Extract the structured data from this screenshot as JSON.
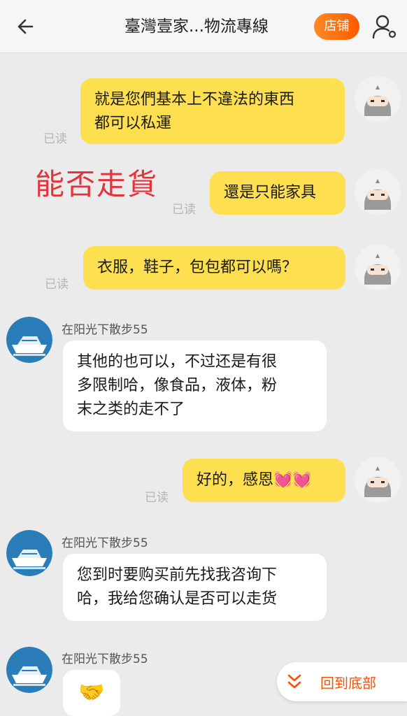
{
  "header": {
    "title": "臺灣壹家...物流專線",
    "shop_label": "店铺"
  },
  "watermark": "能否走貨",
  "messages": [
    {
      "text_lines": [
        "就是您們基本上不違法的東西",
        "都可以私運"
      ],
      "read": "已读"
    },
    {
      "text": "還是只能家具",
      "read": "已读"
    },
    {
      "text": "衣服，鞋子，包包都可以嗎？",
      "read": "已读"
    },
    {
      "sender": "在阳光下散步55",
      "text_lines": [
        "其他的也可以，不过还是有很",
        "多限制哈，像食品，液体，粉",
        "末之类的走不了"
      ]
    },
    {
      "text": "好的，感恩💓💓",
      "read": "已读"
    },
    {
      "sender": "在阳光下散步55",
      "text_lines": [
        "您到时要购买前先找我咨询下",
        "哈，我给您确认是否可以走货"
      ]
    },
    {
      "sender": "在阳光下散步55",
      "text": "🤝"
    }
  ],
  "floating": {
    "label": "回到底部"
  },
  "colors": {
    "me_bubble": "#fddf4f",
    "accent": "#ff5000"
  }
}
